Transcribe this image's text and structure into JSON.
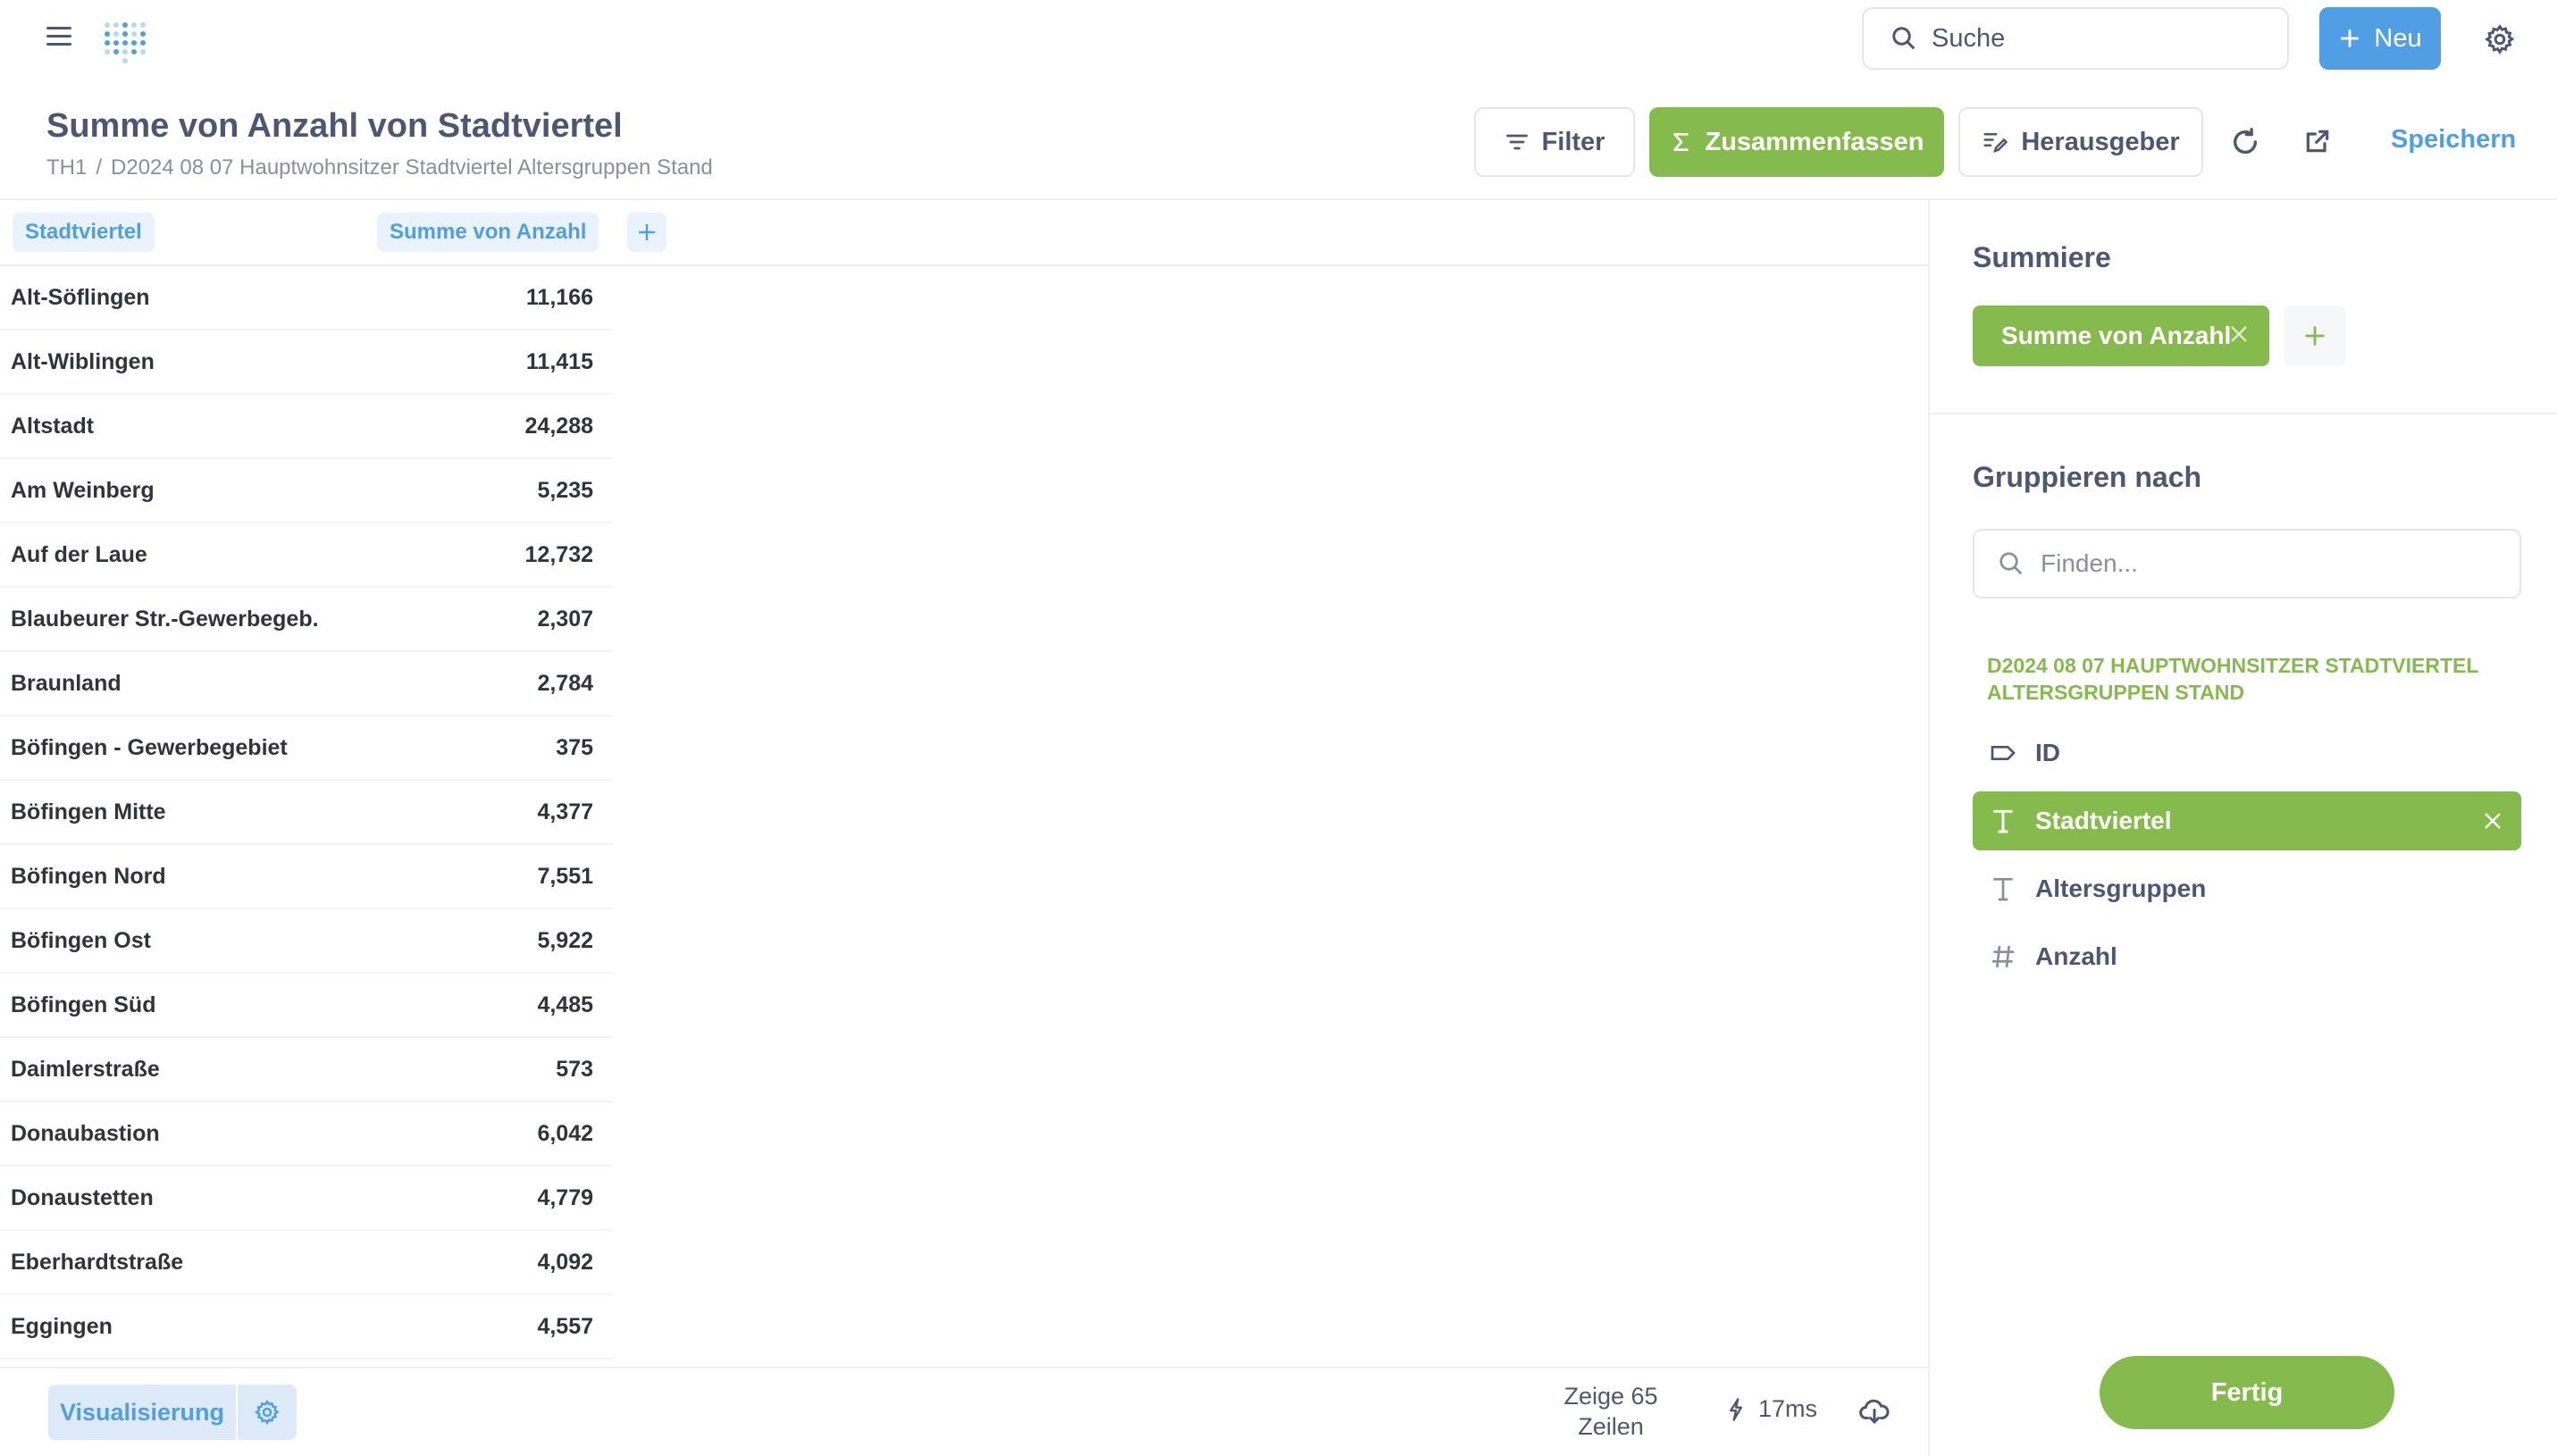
{
  "nav": {
    "search_label": "Suche",
    "new_label": "Neu"
  },
  "header": {
    "title": "Summe von Anzahl von Stadtviertel",
    "breadcrumb": [
      "TH1",
      "D2024 08 07 Hauptwohnsitzer Stadtviertel Altersgruppen Stand"
    ],
    "filter_label": "Filter",
    "summarize_label": "Zusammenfassen",
    "editor_label": "Herausgeber",
    "save_label": "Speichern"
  },
  "table": {
    "columns": [
      "Stadtviertel",
      "Summe von Anzahl"
    ],
    "rows": [
      [
        "Alt-Söflingen",
        "11,166"
      ],
      [
        "Alt-Wiblingen",
        "11,415"
      ],
      [
        "Altstadt",
        "24,288"
      ],
      [
        "Am Weinberg",
        "5,235"
      ],
      [
        "Auf der Laue",
        "12,732"
      ],
      [
        "Blaubeurer Str.-Gewerbegeb.",
        "2,307"
      ],
      [
        "Braunland",
        "2,784"
      ],
      [
        "Böfingen - Gewerbegebiet",
        "375"
      ],
      [
        "Böfingen Mitte",
        "4,377"
      ],
      [
        "Böfingen Nord",
        "7,551"
      ],
      [
        "Böfingen Ost",
        "5,922"
      ],
      [
        "Böfingen Süd",
        "4,485"
      ],
      [
        "Daimlerstraße",
        "573"
      ],
      [
        "Donaubastion",
        "6,042"
      ],
      [
        "Donaustetten",
        "4,779"
      ],
      [
        "Eberhardtstraße",
        "4,092"
      ],
      [
        "Eggingen",
        "4,557"
      ]
    ]
  },
  "footer": {
    "visualization_label": "Visualisierung",
    "row_count_line1": "Zeige 65",
    "row_count_line2": "Zeilen",
    "timing": "17ms"
  },
  "sidebar": {
    "summarize_title": "Summiere",
    "metric_chip": "Summe von Anzahl",
    "group_title": "Gruppieren nach",
    "find_placeholder": "Finden...",
    "table_name": "D2024 08 07 HAUPTWOHNSITZER STADTVIERTEL ALTERSGRUPPEN STAND",
    "fields": [
      {
        "name": "ID",
        "icon": "label-icon",
        "active": false
      },
      {
        "name": "Stadtviertel",
        "icon": "text-icon",
        "active": true
      },
      {
        "name": "Altersgruppen",
        "icon": "text-icon",
        "active": false
      },
      {
        "name": "Anzahl",
        "icon": "number-icon",
        "active": false
      }
    ],
    "done_label": "Fertig"
  },
  "colors": {
    "accent_blue": "#509ee3",
    "accent_green": "#84bb4c",
    "text": "#4c5773"
  }
}
